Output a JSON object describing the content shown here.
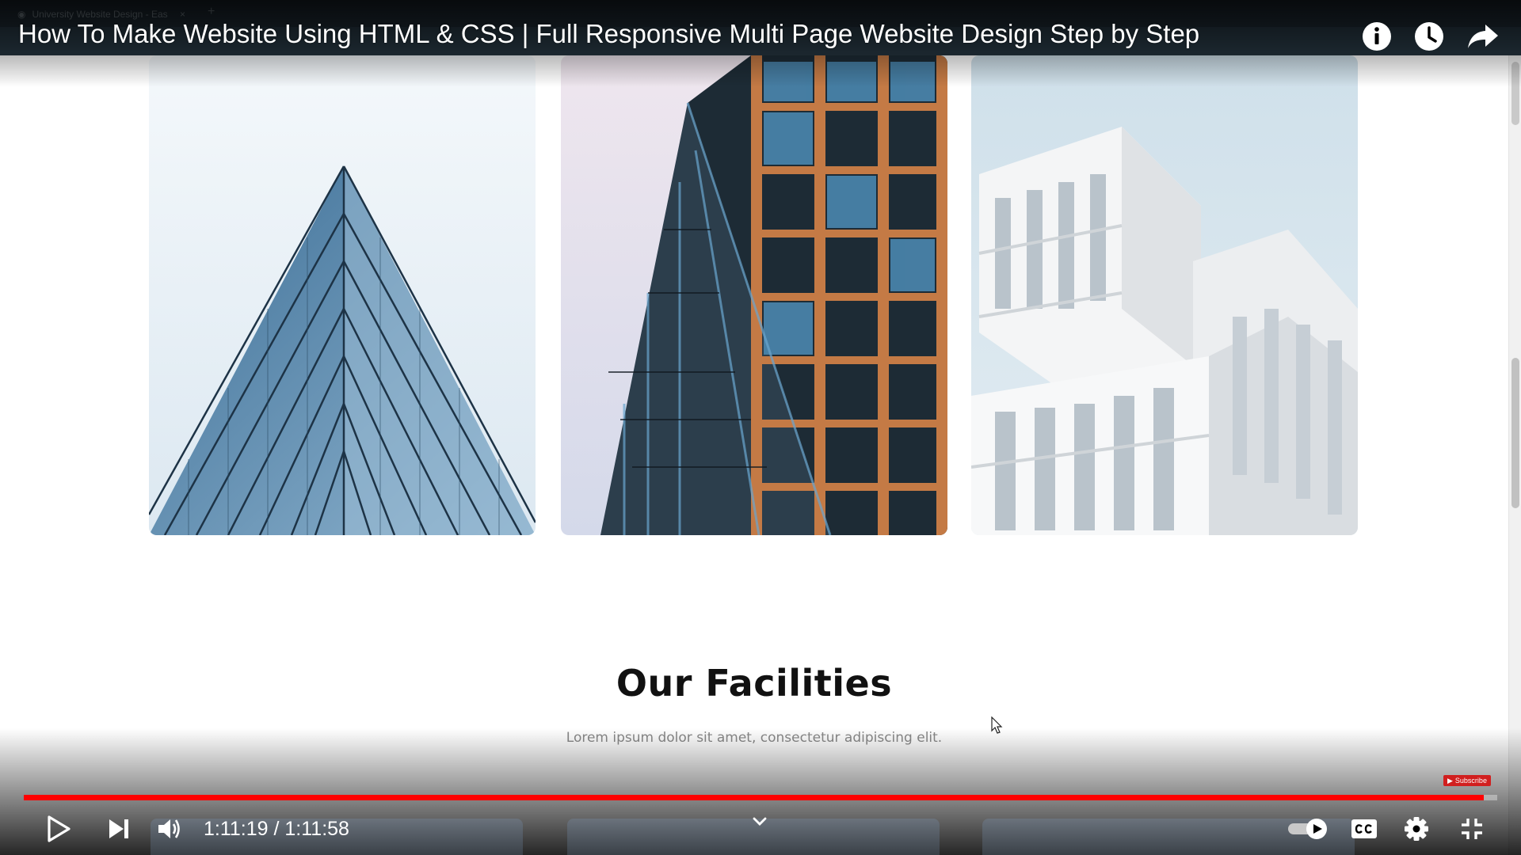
{
  "video": {
    "title": "How To Make Website Using HTML & CSS | Full Responsive Multi Page Website Design Step by Step",
    "current_time": "1:11:19",
    "duration": "1:11:58",
    "time_separator": " / ",
    "progress_fraction": 0.991,
    "subscribe_label": "Subscribe"
  },
  "recorded_page": {
    "browser_tab_title": "University Website Design - Eas",
    "section_title": "Our Facilities",
    "section_subtitle": "Lorem ipsum dolor sit amet, consectetur adipiscing elit."
  },
  "colors": {
    "progress": "#ff0000",
    "accent": "#d11f1f"
  },
  "icons": {
    "top": [
      "info-icon",
      "watch-later-icon",
      "share-icon"
    ],
    "controls": [
      "play-icon",
      "next-icon",
      "volume-icon",
      "chevron-down-icon",
      "autoplay-toggle-icon",
      "closed-captions-icon",
      "settings-gear-icon",
      "exit-fullscreen-icon"
    ]
  }
}
